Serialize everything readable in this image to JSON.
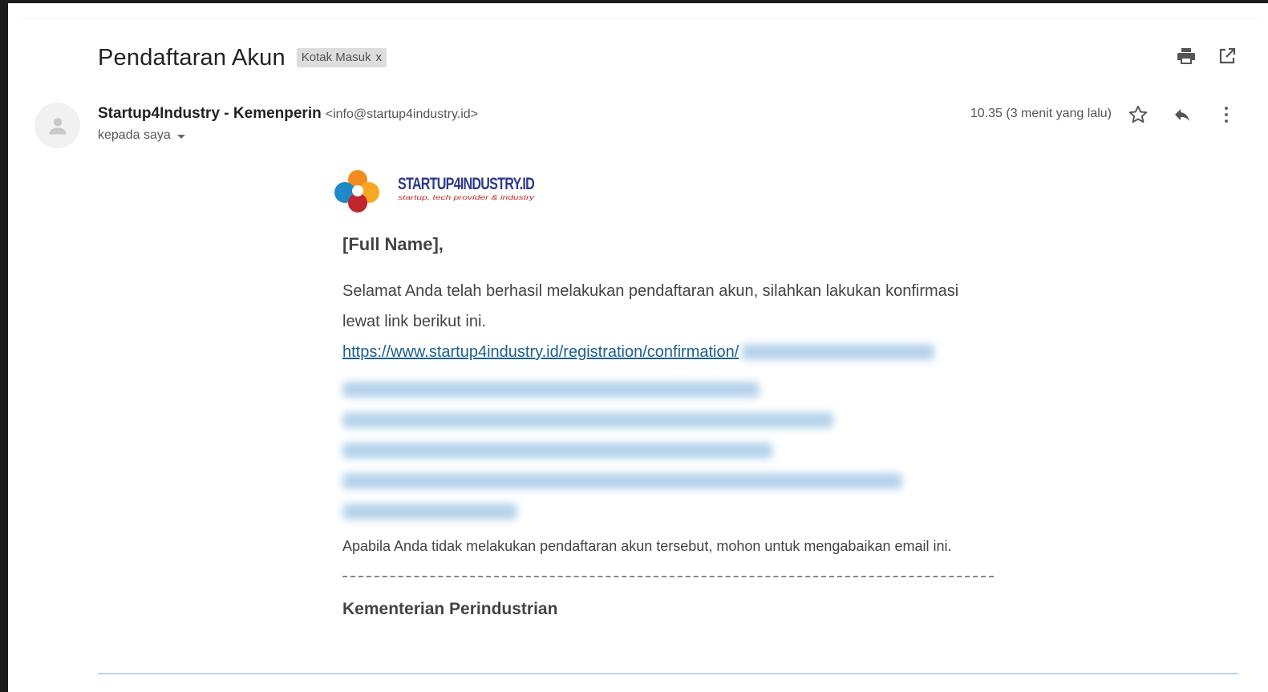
{
  "email": {
    "subject": "Pendaftaran Akun",
    "label": "Kotak Masuk",
    "label_remove": "x",
    "sender_name": "Startup4Industry - Kemenperin",
    "sender_email": "<info@startup4industry.id>",
    "recipient": "kepada saya",
    "timestamp": "10.35 (3 menit yang lalu)"
  },
  "logo": {
    "wordmark": "STARTUP4INDUSTRY.ID",
    "tagline": "startup, tech provider & industry"
  },
  "message": {
    "greeting": "[Full Name],",
    "intro": "Selamat Anda telah berhasil melakukan pendaftaran akun, silahkan lakukan konfirmasi lewat link berikut ini.",
    "link": "https://www.startup4industry.id/registration/confirmation/",
    "disclaimer": "Apabila Anda tidak melakukan pendaftaran akun tersebut, mohon untuk mengabaikan email ini.",
    "signature": "Kementerian Perindustrian"
  },
  "icons": [
    "print-icon",
    "open-new-window-icon",
    "star-icon",
    "reply-icon",
    "more-vert-icon",
    "person-icon",
    "chevron-down-icon",
    "close-icon"
  ],
  "colors": {
    "link": "#1a5f8e",
    "label_bg": "#dddddd",
    "text": "#444444"
  }
}
